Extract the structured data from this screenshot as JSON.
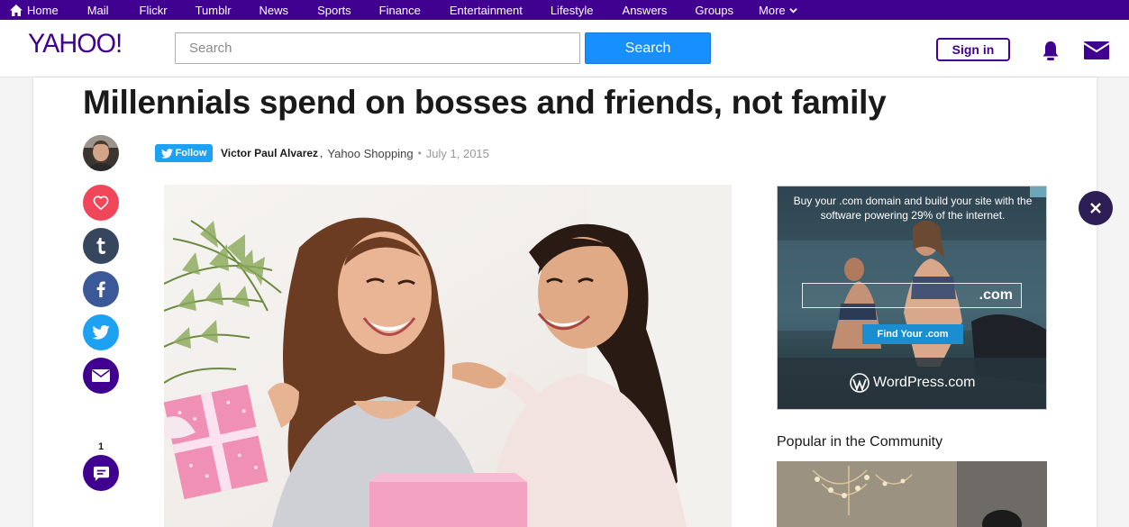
{
  "topnav": {
    "items": [
      "Home",
      "Mail",
      "Flickr",
      "Tumblr",
      "News",
      "Sports",
      "Finance",
      "Entertainment",
      "Lifestyle",
      "Answers",
      "Groups",
      "More"
    ],
    "bg_color": "#400090"
  },
  "header": {
    "logo": "YAHOO!",
    "search_placeholder": "Search",
    "search_button": "Search",
    "signin_label": "Sign in",
    "icons": [
      "bell-icon",
      "mail-icon"
    ]
  },
  "article": {
    "title": "Millennials spend on bosses and friends, not family",
    "follow_label": "Follow",
    "author": "Victor Paul Alvarez",
    "separator": ",",
    "publisher": "Yahoo Shopping",
    "dot": "•",
    "date": "July 1, 2015",
    "share_buttons": [
      "heart-icon",
      "tumblr-icon",
      "facebook-icon",
      "twitter-icon",
      "email-icon"
    ],
    "comment_count": "1",
    "share_colors": {
      "heart": "#f0465a",
      "tumblr": "#36465d",
      "facebook": "#3b5998",
      "twitter": "#1da1f2",
      "email": "#400090",
      "comment": "#400090"
    }
  },
  "ad": {
    "headline": "Buy your .com domain and build your site with the software powering 29% of the internet.",
    "field_text": ".com",
    "button_label": "Find Your .com",
    "brand": "WordPress.com"
  },
  "sidebar": {
    "popular_heading": "Popular in the Community"
  }
}
